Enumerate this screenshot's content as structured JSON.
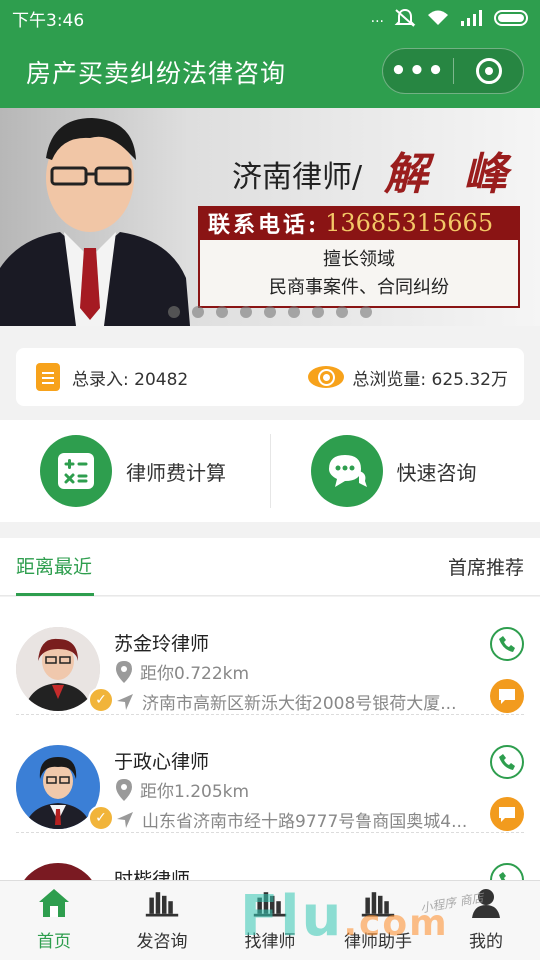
{
  "status_bar": {
    "time": "下午3:46",
    "signal_text": "...",
    "wifi_icon": "wifi-icon",
    "mute_icon": "mute-icon"
  },
  "app": {
    "title": "房产买卖纠纷法律咨询",
    "menu_dots": "•••"
  },
  "banner": {
    "city_name": "济南律师/",
    "lawyer_signature": "解 峰",
    "phone_label": "联系电话:",
    "phone_number": "13685315665",
    "specialty_title": "擅长领域",
    "specialty_text": "民商事案件、合同纠纷",
    "slide_count": 9,
    "active_slide": 1
  },
  "stats": {
    "total_entries_label": "总录入:",
    "total_entries": "20482",
    "total_views_label": "总浏览量:",
    "total_views": "625.32万"
  },
  "actions": [
    {
      "label": "律师费计算",
      "icon": "calculator-icon"
    },
    {
      "label": "快速咨询",
      "icon": "chat-bubbles-icon"
    }
  ],
  "tabs": {
    "nearest": "距离最近",
    "recommended": "首席推荐"
  },
  "lawyers": [
    {
      "name": "苏金玲律师",
      "distance": "距你0.722km",
      "address": "济南市高新区新泺大街2008号银荷大厦..."
    },
    {
      "name": "于政心律师",
      "distance": "距你1.205km",
      "address": "山东省济南市经十路9777号鲁商国奥城4..."
    },
    {
      "name": "时楷律师",
      "distance": "",
      "address": ""
    }
  ],
  "bottom_nav": [
    {
      "label": "首页",
      "icon": "home-icon",
      "active": true
    },
    {
      "label": "发咨询",
      "icon": "building-icon",
      "active": false
    },
    {
      "label": "找律师",
      "icon": "building-icon",
      "active": false
    },
    {
      "label": "律师助手",
      "icon": "building-icon",
      "active": false
    },
    {
      "label": "我的",
      "icon": "user-icon",
      "active": false
    }
  ],
  "watermark": {
    "text": "Flu",
    "suffix": ".com",
    "small": "小程序 商店"
  },
  "colors": {
    "primary": "#2e9e4e",
    "accent": "#f7a21b",
    "banner_red": "#8a1414"
  }
}
